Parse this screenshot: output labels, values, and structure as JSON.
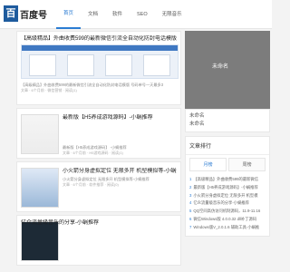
{
  "header": {
    "logo_mark": "百",
    "logo_text": "百度号",
    "nav": [
      "首页",
      "文档",
      "软件",
      "SEO",
      "无限音乐"
    ]
  },
  "main": {
    "feature": {
      "title": "【高级精品】外曲收费599的最新微信引流全自动化防封电话模版，号码单号一天最",
      "excerpt": "【高级精品】外曲收费599的最新微信引流全自动化防封电话模版 号码单号一天最多3",
      "meta": "文章 · 6个月前 · 微信营销 · 阅读(1)"
    },
    "posts": [
      {
        "title": "最新版【H5养成游戏源码】-小蜗推荐",
        "excerpt": "最新版【H5养成游戏源码】 -小蜗推荐",
        "meta": "文章 · 6个月前 · H5游戏源码 · 阅读(1)"
      },
      {
        "title": "小火箭分身虚拟定位 无限多开 机型模拟等-小蜗推荐",
        "excerpt": "小火箭分身虚拟定位 无限多开 机型模拟等-小蜗推荐",
        "meta": "文章 · 6个月前 · 软件推荐 · 阅读(0)"
      }
    ],
    "last_title": "亿众流量级音乐的分享-小蜗推荐"
  },
  "sidebar": {
    "hero_label": "未命名",
    "links": [
      "未命名",
      "未命名"
    ],
    "rank": {
      "title": "文章排行",
      "tabs": [
        "月榜",
        "周榜"
      ],
      "items": [
        "【高级精品】外曲收费599的最新微信",
        "最新版【H5养成游戏源码】-小蜗推荐",
        "小火箭分身虚拟定位 无限多开 机型模",
        "亿众流量级音乐的分享-小蜗推荐",
        "QQ空间高仿访问机制源码，11.9-11.16",
        "微信Windows版 4.0.0.32 dll补丁源码",
        "Windows版V_2.0.1.6 辅助工具-小蜗推"
      ]
    }
  }
}
